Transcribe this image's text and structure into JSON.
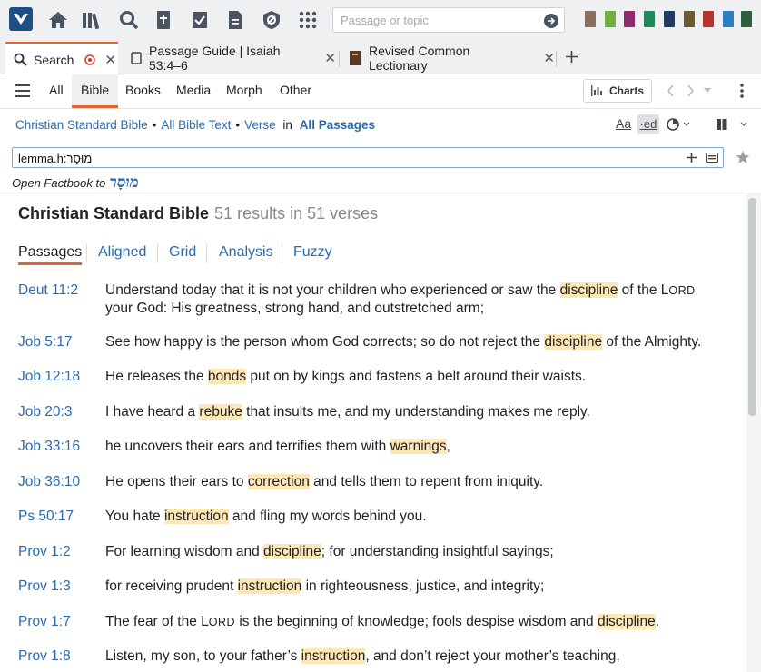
{
  "topbar": {
    "passage_placeholder": "Passage or topic"
  },
  "tabs": [
    {
      "label": "Search"
    },
    {
      "label": "Passage Guide | Isaiah 53:4–6"
    },
    {
      "label": "Revised Common Lectionary"
    }
  ],
  "nav": {
    "tabs": [
      "All",
      "Bible",
      "Books",
      "Media",
      "Morph",
      "Other"
    ],
    "active": "Bible",
    "charts_label": "Charts"
  },
  "crumbs": {
    "version": "Christian Standard Bible",
    "scope": "All Bible Text",
    "unit": "Verse",
    "in": "in",
    "range": "All Passages",
    "dot": "•"
  },
  "toolbar_right": {
    "aa_label": "Aa",
    "ed_label": "·ed"
  },
  "search": {
    "query": "lemma.h:מוּסָר"
  },
  "factbook": {
    "label": "Open Factbook to",
    "word": "מוּסָר"
  },
  "results": {
    "title": "Christian Standard Bible",
    "count": "51 results in 51 verses",
    "view_tabs": [
      "Passages",
      "Aligned",
      "Grid",
      "Analysis",
      "Fuzzy"
    ],
    "active_view": "Passages",
    "rows": [
      {
        "ref": "Deut 11:2",
        "parts": [
          {
            "t": "Understand today that it is not your children who experienced or saw the "
          },
          {
            "t": "discipline",
            "hl": true
          },
          {
            "t": " of the L"
          },
          {
            "t": "ORD",
            "sc": true
          },
          {
            "t": " your God: His greatness, strong hand, and outstretched arm;"
          }
        ]
      },
      {
        "ref": "Job 5:17",
        "parts": [
          {
            "t": "See how happy is the person whom God corrects; so do not reject the "
          },
          {
            "t": "discipline",
            "hl": true
          },
          {
            "t": " of the Almighty."
          }
        ]
      },
      {
        "ref": "Job 12:18",
        "parts": [
          {
            "t": "He releases the "
          },
          {
            "t": "bonds",
            "hl": true
          },
          {
            "t": " put on by kings and fastens a belt around their waists."
          }
        ]
      },
      {
        "ref": "Job 20:3",
        "parts": [
          {
            "t": "I have heard a "
          },
          {
            "t": "rebuke",
            "hl": true
          },
          {
            "t": " that insults me, and my understanding makes me reply."
          }
        ]
      },
      {
        "ref": "Job 33:16",
        "parts": [
          {
            "t": "he uncovers their ears and terrifies them with "
          },
          {
            "t": "warnings",
            "hl": true
          },
          {
            "t": ","
          }
        ]
      },
      {
        "ref": "Job 36:10",
        "parts": [
          {
            "t": "He opens their ears to "
          },
          {
            "t": "correction",
            "hl": true
          },
          {
            "t": " and tells them to repent from iniquity."
          }
        ]
      },
      {
        "ref": "Ps 50:17",
        "parts": [
          {
            "t": "You hate "
          },
          {
            "t": "instruction",
            "hl": true
          },
          {
            "t": " and fling my words behind you."
          }
        ]
      },
      {
        "ref": "Prov 1:2",
        "parts": [
          {
            "t": "For learning wisdom and "
          },
          {
            "t": "discipline",
            "hl": true
          },
          {
            "t": "; for understanding insightful sayings;"
          }
        ]
      },
      {
        "ref": "Prov 1:3",
        "parts": [
          {
            "t": "for receiving prudent "
          },
          {
            "t": "instruction",
            "hl": true
          },
          {
            "t": " in righteousness, justice, and integrity;"
          }
        ]
      },
      {
        "ref": "Prov 1:7",
        "parts": [
          {
            "t": "The fear of the L"
          },
          {
            "t": "ORD",
            "sc": true
          },
          {
            "t": " is the beginning of knowledge; fools despise wisdom and "
          },
          {
            "t": "discipline",
            "hl": true
          },
          {
            "t": "."
          }
        ]
      },
      {
        "ref": "Prov 1:8",
        "parts": [
          {
            "t": "Listen, my son, to your father’s "
          },
          {
            "t": "instruction",
            "hl": true
          },
          {
            "t": ", and don’t reject your mother’s teaching,"
          }
        ]
      }
    ]
  },
  "colors": {
    "accent": "#e8622d",
    "link": "#2a6ab0",
    "highlight": "#fde8b5",
    "brand": "#1f4f82"
  }
}
